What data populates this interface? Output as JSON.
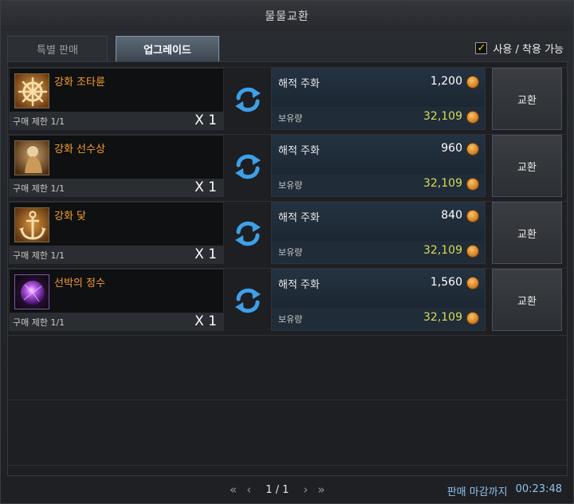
{
  "window": {
    "title": "물물교환"
  },
  "tabs": [
    {
      "label": "특별 판매",
      "active": false
    },
    {
      "label": "업그레이드",
      "active": true
    }
  ],
  "filter": {
    "label": "사용 / 착용 가능",
    "checked": true
  },
  "currency": {
    "name": "해적 주화",
    "owned_label": "보유량"
  },
  "items": [
    {
      "name": "강화 조타륜",
      "limit": "구매 제한 1/1",
      "qty": "X 1",
      "cost_name": "해적 주화",
      "cost": "1,200",
      "owned_label": "보유량",
      "owned": "32,109",
      "button": "교환",
      "icon": "ship-wheel-icon"
    },
    {
      "name": "강화 선수상",
      "limit": "구매 제한 1/1",
      "qty": "X 1",
      "cost_name": "해적 주화",
      "cost": "960",
      "owned_label": "보유량",
      "owned": "32,109",
      "button": "교환",
      "icon": "figurehead-icon"
    },
    {
      "name": "강화 닻",
      "limit": "구매 제한 1/1",
      "qty": "X 1",
      "cost_name": "해적 주화",
      "cost": "840",
      "owned_label": "보유량",
      "owned": "32,109",
      "button": "교환",
      "icon": "anchor-icon"
    },
    {
      "name": "선박의 정수",
      "limit": "구매 제한 1/1",
      "qty": "X 1",
      "cost_name": "해적 주화",
      "cost": "1,560",
      "owned_label": "보유량",
      "owned": "32,109",
      "button": "교환",
      "icon": "orb-icon"
    }
  ],
  "pagination": {
    "current": "1 / 1",
    "first": "«",
    "prev": "‹",
    "next": "›",
    "last": "»"
  },
  "deadline": {
    "label": "판매 마감까지",
    "time": "00:23:48"
  },
  "colors": {
    "item_name": "#f7a02a",
    "owned_value": "#d9dd58",
    "deadline": "#8fc2ec",
    "check": "#e8c23a"
  }
}
